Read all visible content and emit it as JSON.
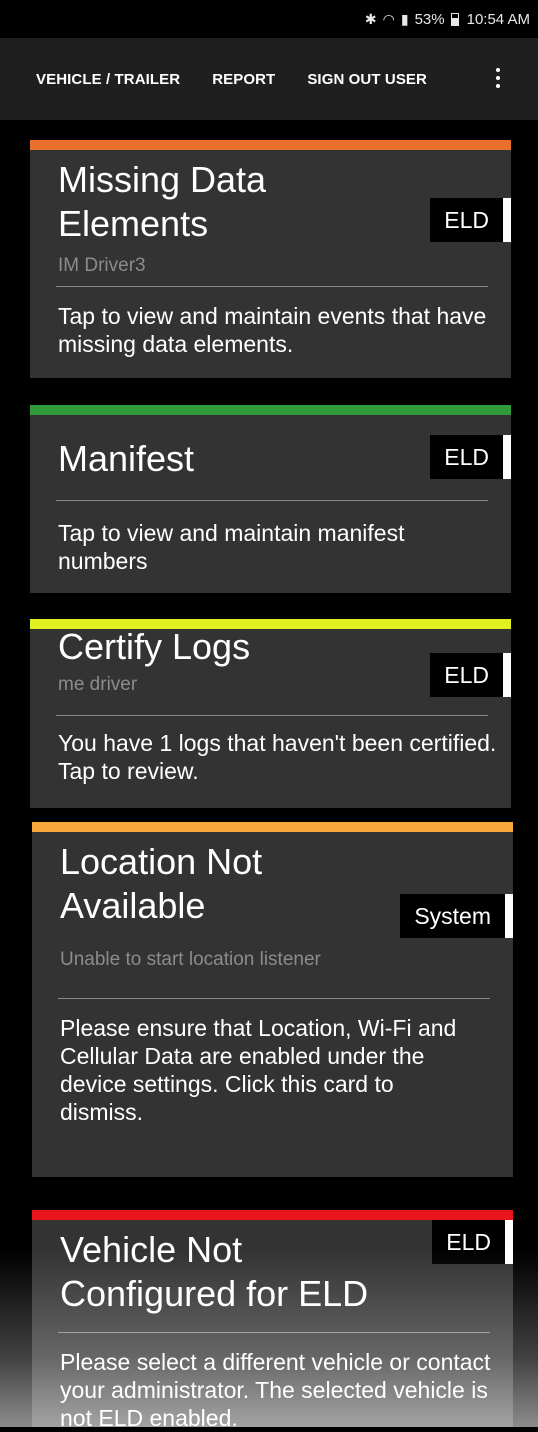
{
  "status_bar": {
    "battery": "53%",
    "time": "10:54 AM",
    "icons": [
      "bluetooth-icon",
      "wifi-icon",
      "signal-icon",
      "battery-icon"
    ]
  },
  "action_bar": {
    "items": [
      "VEHICLE / TRAILER",
      "REPORT",
      "SIGN OUT USER"
    ],
    "overflow_icon": "more-vert-icon"
  },
  "cards": [
    {
      "title": "Missing Data Elements",
      "subtitle": "IM Driver3",
      "badge": "ELD",
      "description": "Tap to view and maintain events that have missing data elements.",
      "color": "#e8702c"
    },
    {
      "title": "Manifest",
      "subtitle": "",
      "badge": "ELD",
      "description": "Tap to view and maintain manifest numbers",
      "color": "#2e9a3a"
    },
    {
      "title": "Certify Logs",
      "subtitle": "me driver",
      "badge": "ELD",
      "description": "You have 1 logs that haven't been certified. Tap to review.",
      "color": "#e1f020"
    },
    {
      "title": "Location Not Available",
      "subtitle": "Unable to start location listener",
      "badge": "System",
      "description": "Please ensure that Location, Wi-Fi and Cellular Data are enabled under the device settings. Click this card to dismiss.",
      "color": "#f6a93a"
    },
    {
      "title": "Vehicle Not Configured for ELD",
      "subtitle": "",
      "badge": "ELD",
      "description": "Please select a different vehicle or contact your administrator. The selected vehicle is not ELD enabled.",
      "color": "#e8161b"
    }
  ]
}
